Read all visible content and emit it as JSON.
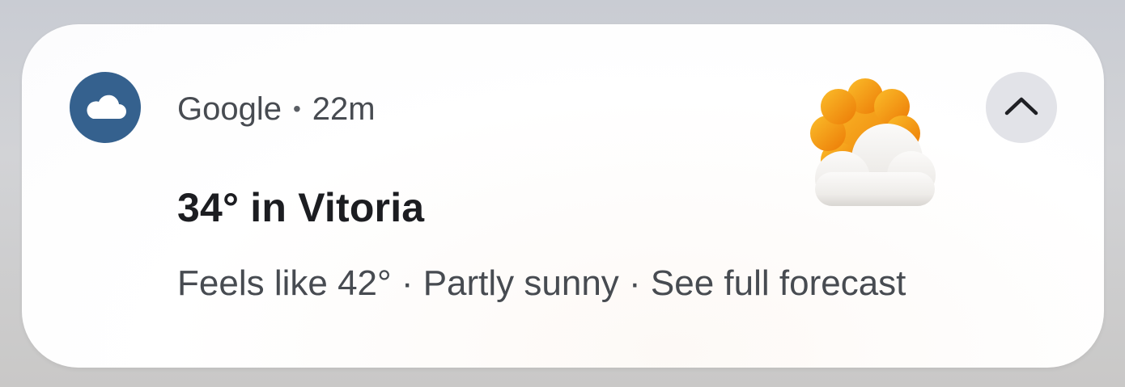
{
  "notification": {
    "app_icon": "cloud-icon",
    "app_name": "Google",
    "separator": "•",
    "time_ago": "22m",
    "title": "34° in Vitoria",
    "body": "Feels like 42° · Partly sunny · See full forecast",
    "weather_icon": "partly-sunny-icon",
    "expand_icon": "chevron-up-icon"
  },
  "colors": {
    "app_icon_bg": "#35618e",
    "expand_button_bg": "#e2e3e8",
    "title_text": "#1c1d21",
    "secondary_text": "#474b51",
    "sun": "#f59a14",
    "cloud": "#f3f2f1"
  }
}
